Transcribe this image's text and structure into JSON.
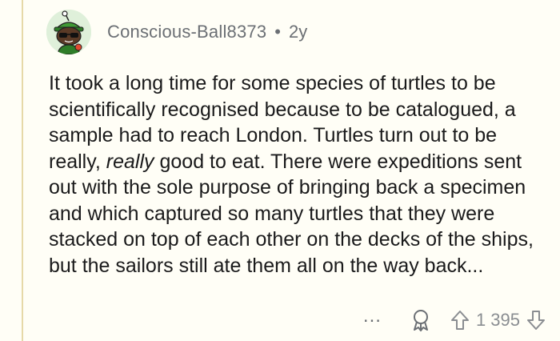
{
  "comment": {
    "username": "Conscious-Ball8373",
    "separator": "•",
    "age": "2y",
    "body_before_em": "It took a long time for some species of turtles to be scientifically recognised because to be catalogued, a sample had to reach London. Turtles turn out to be really, ",
    "body_em": "really",
    "body_after_em": " good to eat. There were expeditions sent out with the sole purpose of bringing back a specimen and which captured so many turtles that they were stacked on top of each other on the decks of the ships, but the sailors still ate them all on the way back...",
    "more_label": "...",
    "score": "1 395"
  },
  "icons": {
    "avatar": "snoo-avatar-icon",
    "award": "award-icon",
    "upvote": "upvote-arrow-icon",
    "downvote": "downvote-arrow-icon"
  },
  "colors": {
    "background": "#fffef6",
    "thread_line": "#e6d9a8",
    "meta_text": "#6b6f74",
    "body_text": "#1a1a1b"
  }
}
